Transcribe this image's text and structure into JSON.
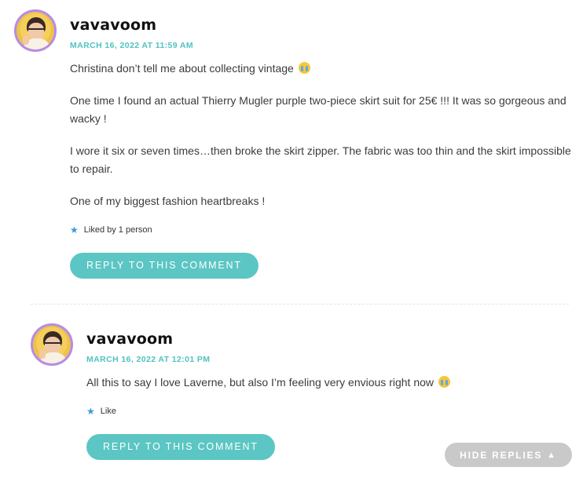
{
  "comments": [
    {
      "author": "vavavoom",
      "timestamp": "MARCH 16, 2022 AT 11:59 AM",
      "paragraphs": [
        "Christina don’t tell me about collecting vintage",
        "One time I found an actual Thierry Mugler purple two-piece skirt suit for 25€ !!! It was so gorgeous and wacky !",
        "I wore it six or seven times…then broke the skirt zipper. The fabric was too thin and the skirt impossible to repair.",
        "One of my biggest fashion heartbreaks !"
      ],
      "emoji_icon": "crying-face-emoji",
      "like_text": "Liked by 1 person",
      "reply_label": "REPLY TO THIS COMMENT"
    },
    {
      "author": "vavavoom",
      "timestamp": "MARCH 16, 2022 AT 12:01 PM",
      "paragraphs": [
        "All this to say I love Laverne, but also I’m feeling very envious right now"
      ],
      "emoji_icon": "crying-face-emoji",
      "like_text": "Like",
      "reply_label": "REPLY TO THIS COMMENT"
    }
  ],
  "hide_replies_label": "HIDE REPLIES",
  "hide_replies_icon": "triangle-up-icon",
  "colors": {
    "accent": "#5bc6c3",
    "timestamp": "#4ec3c0",
    "avatar_border": "#b58ce6",
    "star": "#3a9bd5",
    "hide_replies_bg": "#c9c9c9"
  }
}
